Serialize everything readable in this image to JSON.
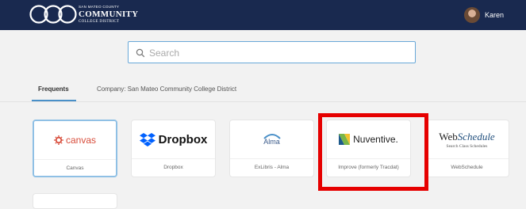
{
  "header": {
    "logo_line1": "SAN MATEO COUNTY",
    "logo_line2": "COMMUNITY",
    "logo_line3": "COLLEGE DISTRICT",
    "user_name": "Karen",
    "background_color": "#19294f"
  },
  "search": {
    "placeholder": "Search",
    "value": "",
    "icon": "search-icon"
  },
  "tabs": [
    {
      "label": "Frequents",
      "active": true
    },
    {
      "label": "Company: San Mateo Community College District",
      "active": false
    }
  ],
  "apps": [
    {
      "label": "Canvas",
      "logo_text": "canvas",
      "icon": "canvas-logo-icon",
      "selected": true
    },
    {
      "label": "Dropbox",
      "logo_text": "Dropbox",
      "icon": "dropbox-logo-icon",
      "selected": false
    },
    {
      "label": "ExLibris - Alma",
      "logo_text": "Alma",
      "icon": "alma-logo-icon",
      "selected": false
    },
    {
      "label": "Improve (formerly Tracdat)",
      "logo_text": "Nuventive.",
      "icon": "nuventive-logo-icon",
      "selected": false,
      "highlighted": true
    },
    {
      "label": "WebSchedule",
      "logo_text_main": "Web",
      "logo_text_italic": "Schedule",
      "logo_subtext": "Search Class Schedules",
      "icon": "webschedule-logo-icon",
      "selected": false
    }
  ],
  "colors": {
    "accent": "#4a90c8",
    "highlight": "#e60000",
    "canvas": "#d84d3b",
    "dropbox": "#0061ff"
  }
}
